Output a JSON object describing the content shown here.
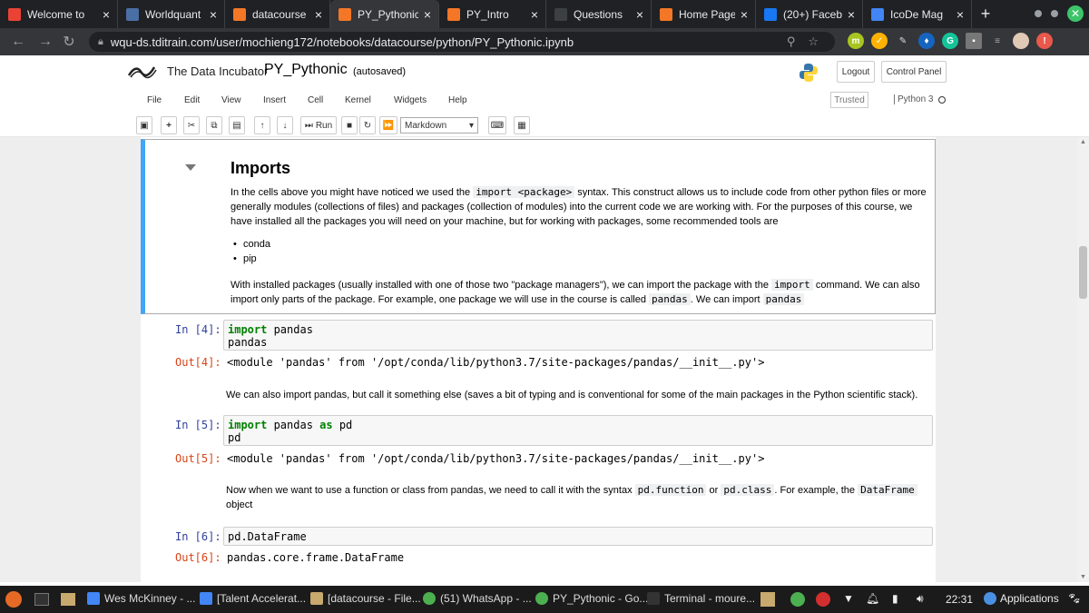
{
  "browser": {
    "tabs": [
      {
        "title": "Welcome to",
        "icon": "gmail-icon",
        "color": "#ea4335"
      },
      {
        "title": "Worldquant",
        "icon": "worldquant-icon",
        "color": "#4a6fa5"
      },
      {
        "title": "datacourse",
        "icon": "jupyter-icon",
        "color": "#f37726"
      },
      {
        "title": "PY_Pythonic",
        "icon": "notebook-icon",
        "color": "#f37726"
      },
      {
        "title": "PY_Intro",
        "icon": "notebook-icon",
        "color": "#f37726"
      },
      {
        "title": "Questions",
        "icon": "questions-icon",
        "color": "#3c4043"
      },
      {
        "title": "Home Page",
        "icon": "jupyter-icon",
        "color": "#f37726"
      },
      {
        "title": "(20+) Faceb",
        "icon": "facebook-icon",
        "color": "#1877f2"
      },
      {
        "title": "IcoDe Mag",
        "icon": "docs-icon",
        "color": "#4285f4"
      }
    ],
    "active_tab": 3,
    "new_tab_label": "+",
    "url": "wqu-ds.tditrain.com/user/mochieng172/notebooks/datacourse/python/PY_Pythonic.ipynb"
  },
  "jupyter": {
    "logo_text": "The Data Incubator",
    "notebook_title": "PY_Pythonic",
    "save_status": "(autosaved)",
    "logout_label": "Logout",
    "control_panel_label": "Control Panel",
    "menus": [
      "File",
      "Edit",
      "View",
      "Insert",
      "Cell",
      "Kernel",
      "Widgets",
      "Help"
    ],
    "trusted_label": "Trusted",
    "kernel_name": "Python 3",
    "run_label": "Run",
    "cell_type": "Markdown"
  },
  "cells": {
    "heading": "Imports",
    "md1_a": "In the cells above you might have noticed we used the ",
    "md1_code": "import <package>",
    "md1_b": " syntax. This construct allows us to include code from other python files or more generally modules (collections of files) and packages (collection of modules) into the current code we are working with. For the purposes of this course, we have installed all the packages you will need on your machine, but for working with packages, some recommended tools are",
    "bullets": [
      "conda",
      "pip"
    ],
    "md2_a": "With installed packages (usually installed with one of those two \"package managers\"), we can import the package with the ",
    "md2_code1": "import",
    "md2_b": " command. We can also import only parts of the package. For example, one package we will use in the course is called ",
    "md2_code2": "pandas",
    "md2_c": ". We can import ",
    "md2_code3": "pandas",
    "in4_prompt": "In [4]:",
    "in4_kw": "import",
    "in4_rest": " pandas",
    "in4_line2": "pandas",
    "out4_prompt": "Out[4]:",
    "out4_text": "<module 'pandas' from '/opt/conda/lib/python3.7/site-packages/pandas/__init__.py'>",
    "md3": "We can also import pandas, but call it something else (saves a bit of typing and is conventional for some of the main packages in the Python scientific stack).",
    "in5_prompt": "In [5]:",
    "in5_kw": "import",
    "in5_mid": " pandas ",
    "in5_kw2": "as",
    "in5_rest": " pd",
    "in5_line2": "pd",
    "out5_prompt": "Out[5]:",
    "out5_text": "<module 'pandas' from '/opt/conda/lib/python3.7/site-packages/pandas/__init__.py'>",
    "md4_a": "Now when we want to use a function or class from pandas, we need to call it with the syntax ",
    "md4_code1": "pd.function",
    "md4_b": " or ",
    "md4_code2": "pd.class",
    "md4_c": ". For example, the ",
    "md4_code3": "DataFrame",
    "md4_d": " object",
    "in6_prompt": "In [6]:",
    "in6_code": "pd.DataFrame",
    "out6_prompt": "Out[6]:",
    "out6_text": "pandas.core.frame.DataFrame"
  },
  "taskbar": {
    "items": [
      {
        "label": "Wes McKinney - ...",
        "icon": "docs-icon",
        "color": "#4285f4"
      },
      {
        "label": "[Talent Accelerat...",
        "icon": "docs-icon",
        "color": "#4285f4"
      },
      {
        "label": "[datacourse - File...",
        "icon": "folder-icon",
        "color": "#c8a96e"
      },
      {
        "label": "(51) WhatsApp - ...",
        "icon": "chrome-icon",
        "color": "#4caf50"
      },
      {
        "label": "PY_Pythonic - Go...",
        "icon": "chrome-icon",
        "color": "#4caf50"
      },
      {
        "label": "Terminal - moure...",
        "icon": "terminal-icon",
        "color": "#333"
      }
    ],
    "clock": "22:31",
    "apps_label": "Applications"
  }
}
